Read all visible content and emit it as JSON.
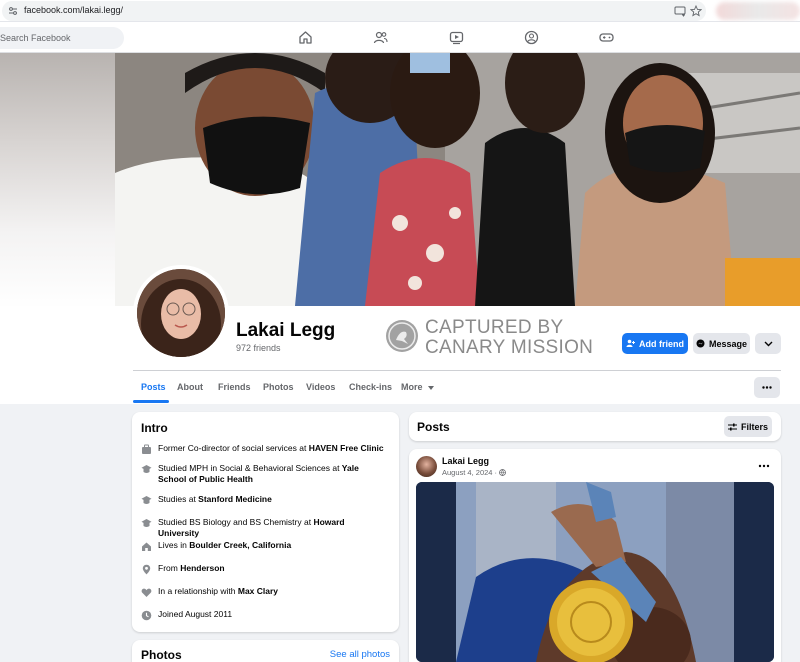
{
  "browser": {
    "url": "facebook.com/lakai.legg/"
  },
  "header": {
    "search_placeholder": "Search Facebook",
    "nav_icons": [
      "home-icon",
      "friends-icon",
      "video-icon",
      "groups-icon",
      "gaming-icon"
    ]
  },
  "profile": {
    "name": "Lakai Legg",
    "friends": "972 friends",
    "add_friend_label": "Add friend",
    "message_label": "Message"
  },
  "watermark": {
    "line1": "CAPTURED BY",
    "line2": "CANARY MISSION"
  },
  "tabs": [
    {
      "label": "Posts",
      "active": true
    },
    {
      "label": "About"
    },
    {
      "label": "Friends"
    },
    {
      "label": "Photos"
    },
    {
      "label": "Videos"
    },
    {
      "label": "Check-ins"
    },
    {
      "label": "More"
    }
  ],
  "intro": {
    "title": "Intro",
    "items": [
      {
        "icon": "work-icon",
        "prefix": "Former Co-director of social services at ",
        "bold": "HAVEN Free Clinic"
      },
      {
        "icon": "education-icon",
        "prefix": "Studied MPH in Social & Behavioral Sciences at ",
        "bold": "Yale School of Public Health"
      },
      {
        "icon": "education-icon",
        "prefix": "Studies at ",
        "bold": "Stanford Medicine"
      },
      {
        "icon": "education-icon",
        "prefix": "Studied BS Biology and BS Chemistry at ",
        "bold": "Howard University"
      },
      {
        "icon": "home-icon",
        "prefix": "Lives in ",
        "bold": "Boulder Creek, California"
      },
      {
        "icon": "location-icon",
        "prefix": "From ",
        "bold": "Henderson"
      },
      {
        "icon": "heart-icon",
        "prefix": "In a relationship with ",
        "bold": "Max Clary"
      },
      {
        "icon": "clock-icon",
        "prefix": "Joined August 2011",
        "bold": ""
      }
    ]
  },
  "photos": {
    "title": "Photos",
    "see_all": "See all photos"
  },
  "posts": {
    "title": "Posts",
    "filters_label": "Filters",
    "post": {
      "author": "Lakai Legg",
      "date": "August 4, 2024 ·",
      "privacy_icon": "globe-icon"
    }
  },
  "colors": {
    "accent": "#1877f2",
    "background": "#f0f2f5",
    "watermark": "#8a8a8a"
  }
}
